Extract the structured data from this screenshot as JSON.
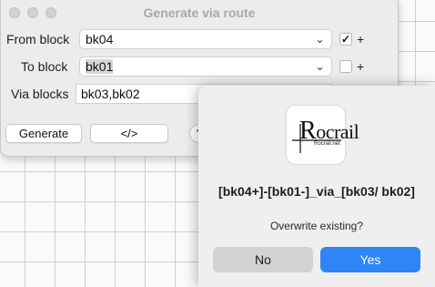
{
  "window": {
    "title": "Generate via route"
  },
  "form": {
    "from_label": "From block",
    "from_value": "bk04",
    "from_plus": "+",
    "from_checked": "✓",
    "to_label": "To block",
    "to_value": "bk01",
    "to_plus": "+",
    "via_label": "Via blocks",
    "via_value": "bk03,bk02"
  },
  "buttons": {
    "generate": "Generate",
    "code": "</>",
    "help": "?"
  },
  "icons": {
    "dropdown": "chevron-down-icon",
    "checkbox": "checkmark-icon"
  },
  "alert": {
    "logo_text": "ocrail",
    "logo_initial": "R",
    "logo_sub": "Rocrail.net",
    "message": "[bk04+]-[bk01-]_via_[bk03/ bk02]",
    "info": "Overwrite existing?",
    "no_label": "No",
    "yes_label": "Yes"
  },
  "colors": {
    "accent": "#2e86f6",
    "window_bg": "#ececec"
  }
}
